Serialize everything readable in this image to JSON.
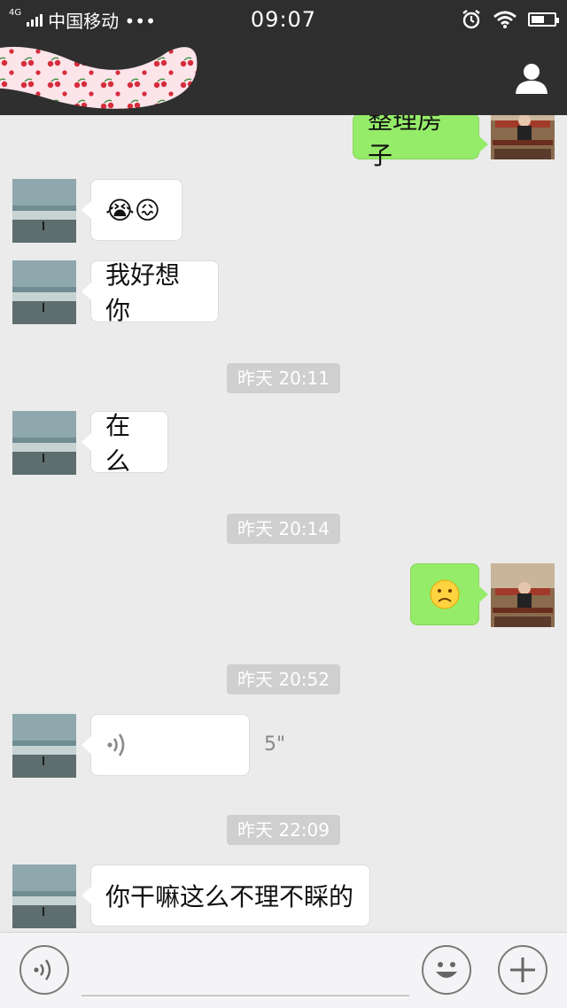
{
  "status_bar": {
    "network_type": "4G",
    "carrier": "中国移动 •••",
    "time": "09:07"
  },
  "header": {
    "profile_icon": "person-icon"
  },
  "messages": [
    {
      "side": "out",
      "type": "text",
      "text": "整理房子"
    },
    {
      "side": "in",
      "type": "emoji",
      "text": "😭😖"
    },
    {
      "side": "in",
      "type": "text",
      "text": "我好想你"
    },
    {
      "type": "time",
      "text": "昨天 20:11"
    },
    {
      "side": "in",
      "type": "text",
      "text": "在么"
    },
    {
      "type": "time",
      "text": "昨天 20:14"
    },
    {
      "side": "out",
      "type": "emoji",
      "text": "☹️"
    },
    {
      "type": "time",
      "text": "昨天 20:52"
    },
    {
      "side": "in",
      "type": "voice",
      "duration": "5\""
    },
    {
      "type": "time",
      "text": "昨天 22:09"
    },
    {
      "side": "in",
      "type": "text",
      "text": "你干嘛这么不理不睬的"
    }
  ],
  "input_bar": {
    "voice_icon": "voice-icon",
    "emoji_icon": "emoji-icon",
    "plus_icon": "plus-icon"
  },
  "colors": {
    "out_bubble": "#95ec69",
    "in_bubble": "#ffffff",
    "background": "#ebebeb",
    "header": "#2f2f2f"
  }
}
